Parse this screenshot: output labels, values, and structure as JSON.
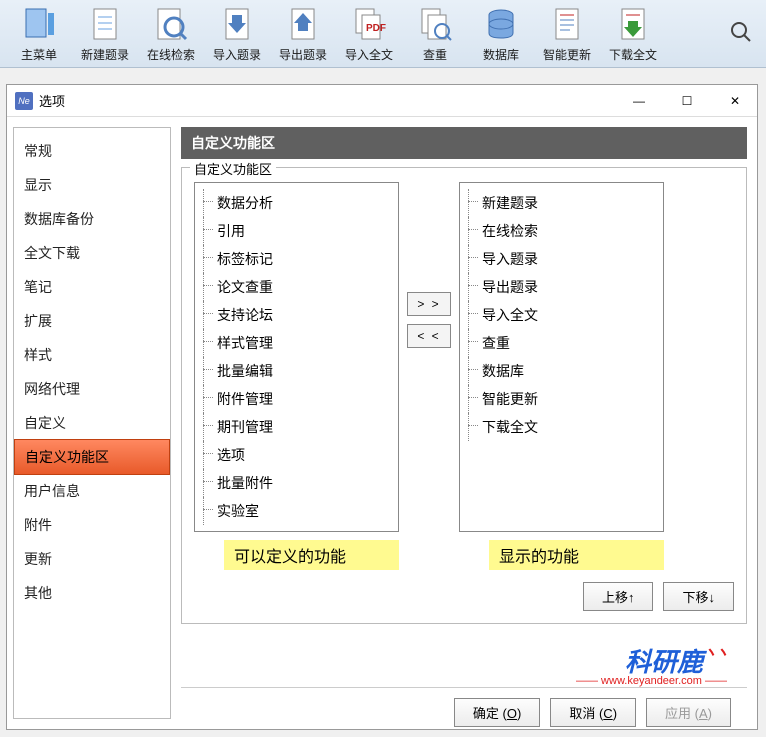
{
  "toolbar": {
    "items": [
      {
        "label": "主菜单",
        "icon": "menu"
      },
      {
        "label": "新建题录",
        "icon": "new"
      },
      {
        "label": "在线检索",
        "icon": "search"
      },
      {
        "label": "导入题录",
        "icon": "import"
      },
      {
        "label": "导出题录",
        "icon": "export"
      },
      {
        "label": "导入全文",
        "icon": "import-full"
      },
      {
        "label": "查重",
        "icon": "dedup"
      },
      {
        "label": "数据库",
        "icon": "database"
      },
      {
        "label": "智能更新",
        "icon": "update"
      },
      {
        "label": "下载全文",
        "icon": "download"
      }
    ]
  },
  "dialog": {
    "title": "选项",
    "nav": [
      "常规",
      "显示",
      "数据库备份",
      "全文下载",
      "笔记",
      "扩展",
      "样式",
      "网络代理",
      "自定义",
      "自定义功能区",
      "用户信息",
      "附件",
      "更新",
      "其他"
    ],
    "nav_active": "自定义功能区",
    "section_title": "自定义功能区",
    "group_label": "自定义功能区",
    "left_list": [
      "数据分析",
      "引用",
      "标签标记",
      "论文查重",
      "支持论坛",
      "样式管理",
      "批量编辑",
      "附件管理",
      "期刊管理",
      "选项",
      "批量附件",
      "实验室"
    ],
    "right_list": [
      "新建题录",
      "在线检索",
      "导入题录",
      "导出题录",
      "导入全文",
      "查重",
      "数据库",
      "智能更新",
      "下载全文"
    ],
    "annotations": {
      "left": "可以定义的功能",
      "right": "显示的功能"
    },
    "move_right": "> >",
    "move_left": "< <",
    "reorder_up": "上移↑",
    "reorder_down": "下移↓",
    "ok": "确定 (O)",
    "cancel": "取消 (C)",
    "apply": "应用 (A)"
  },
  "watermark": {
    "main": "科研鹿",
    "sub": "—— www.keyandeer.com ——"
  }
}
